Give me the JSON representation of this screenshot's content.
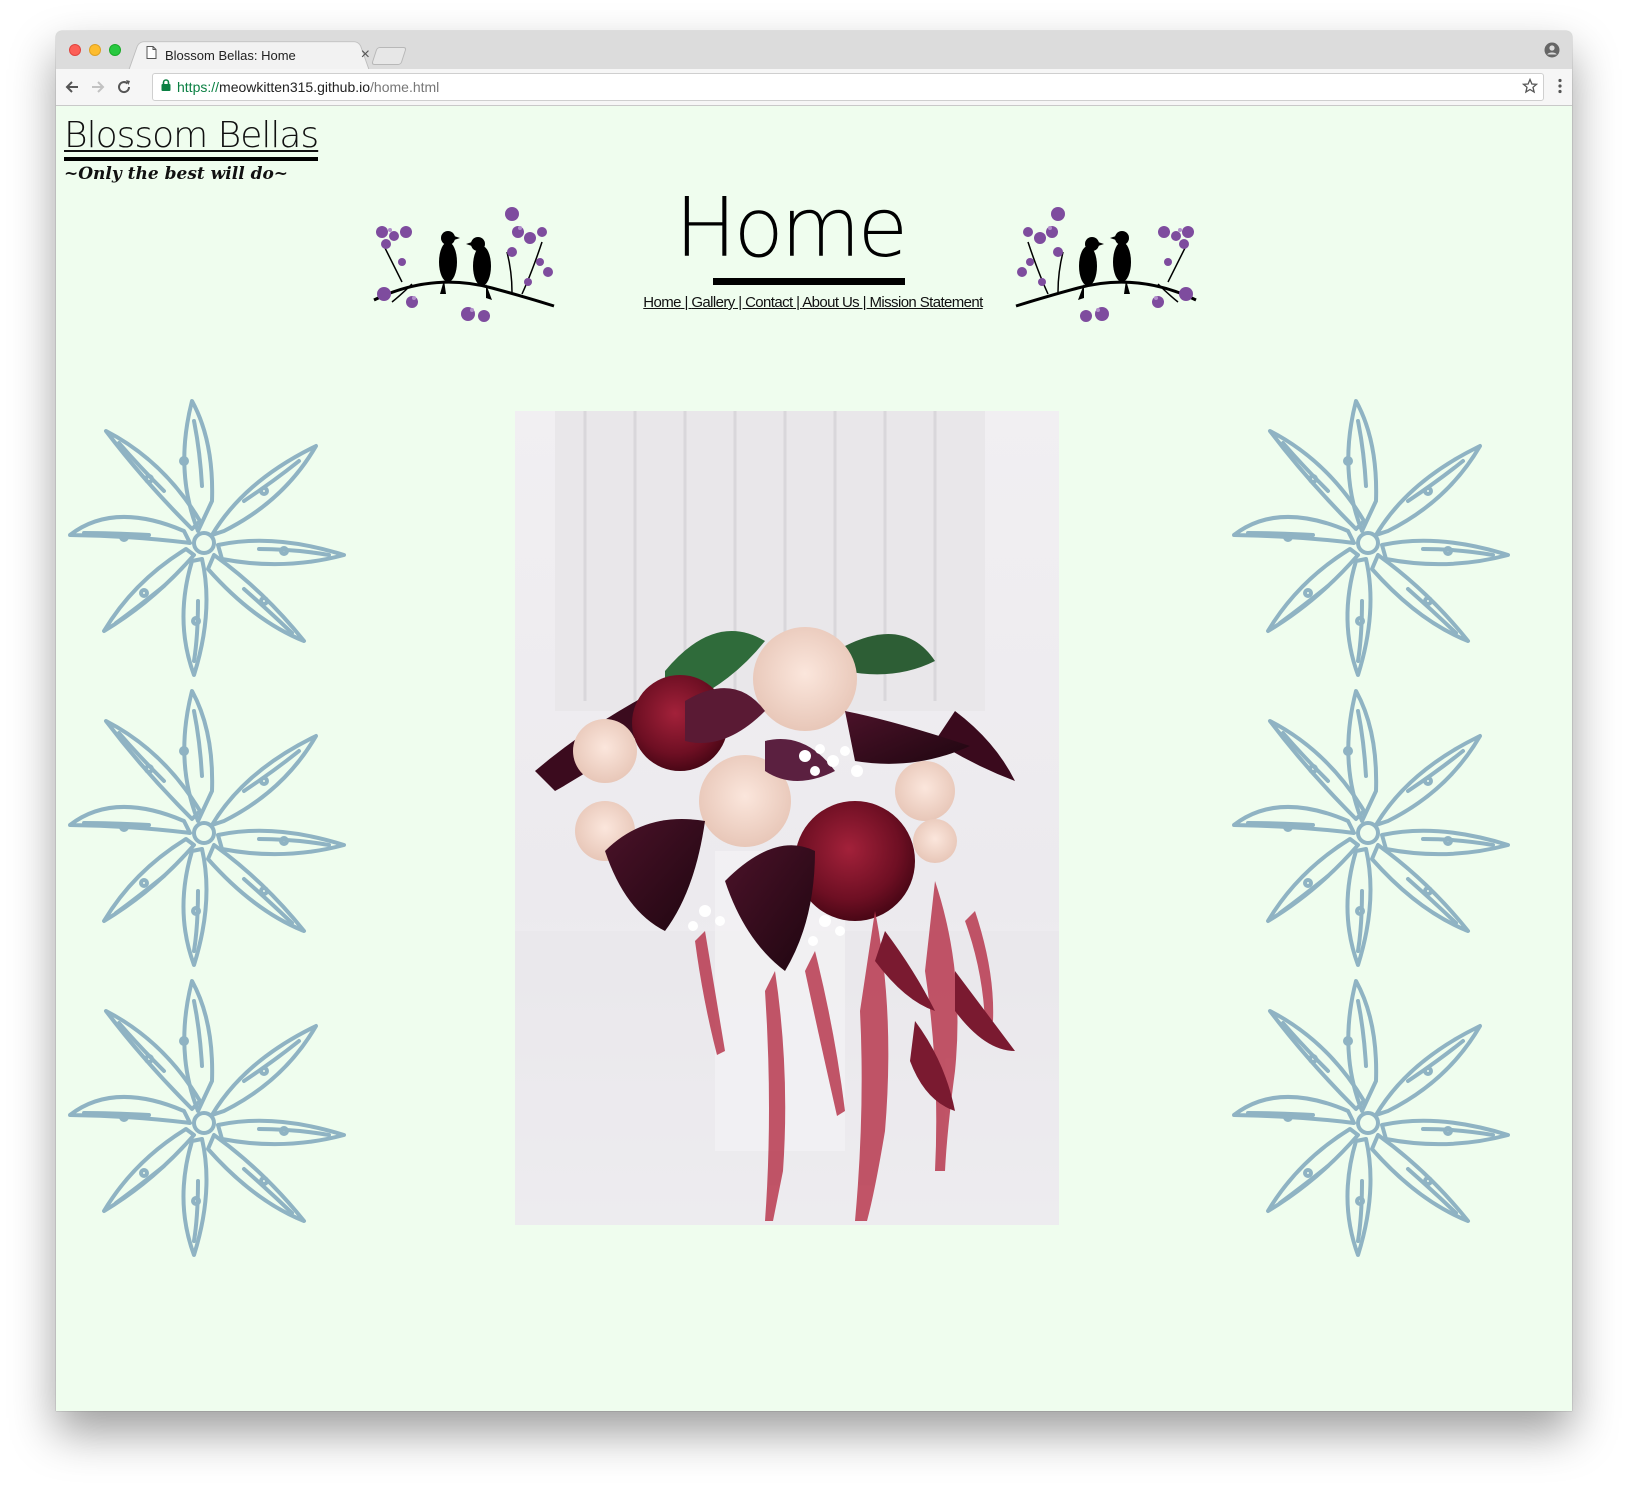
{
  "browser": {
    "tab_title": "Blossom Bellas: Home",
    "url_scheme": "https://",
    "url_host": "meowkitten315.github.io",
    "url_path": "/home.html",
    "icons": [
      "back-arrow-icon",
      "forward-arrow-icon",
      "reload-icon",
      "lock-icon",
      "star-icon",
      "menu-dots-icon",
      "profile-icon",
      "page-icon",
      "close-icon"
    ]
  },
  "site": {
    "title": "Blossom Bellas",
    "tagline": "~Only the best will do~"
  },
  "page": {
    "heading": "Home",
    "nav": [
      {
        "label": "Home"
      },
      {
        "label": "Gallery"
      },
      {
        "label": "Contact"
      },
      {
        "label": "About Us"
      },
      {
        "label": "Mission Statement"
      }
    ],
    "separator": " | "
  },
  "colors": {
    "background": "#effdee",
    "lily": "#8fb3c3",
    "blossom": "#7e4c9e",
    "bird": "#000000"
  }
}
